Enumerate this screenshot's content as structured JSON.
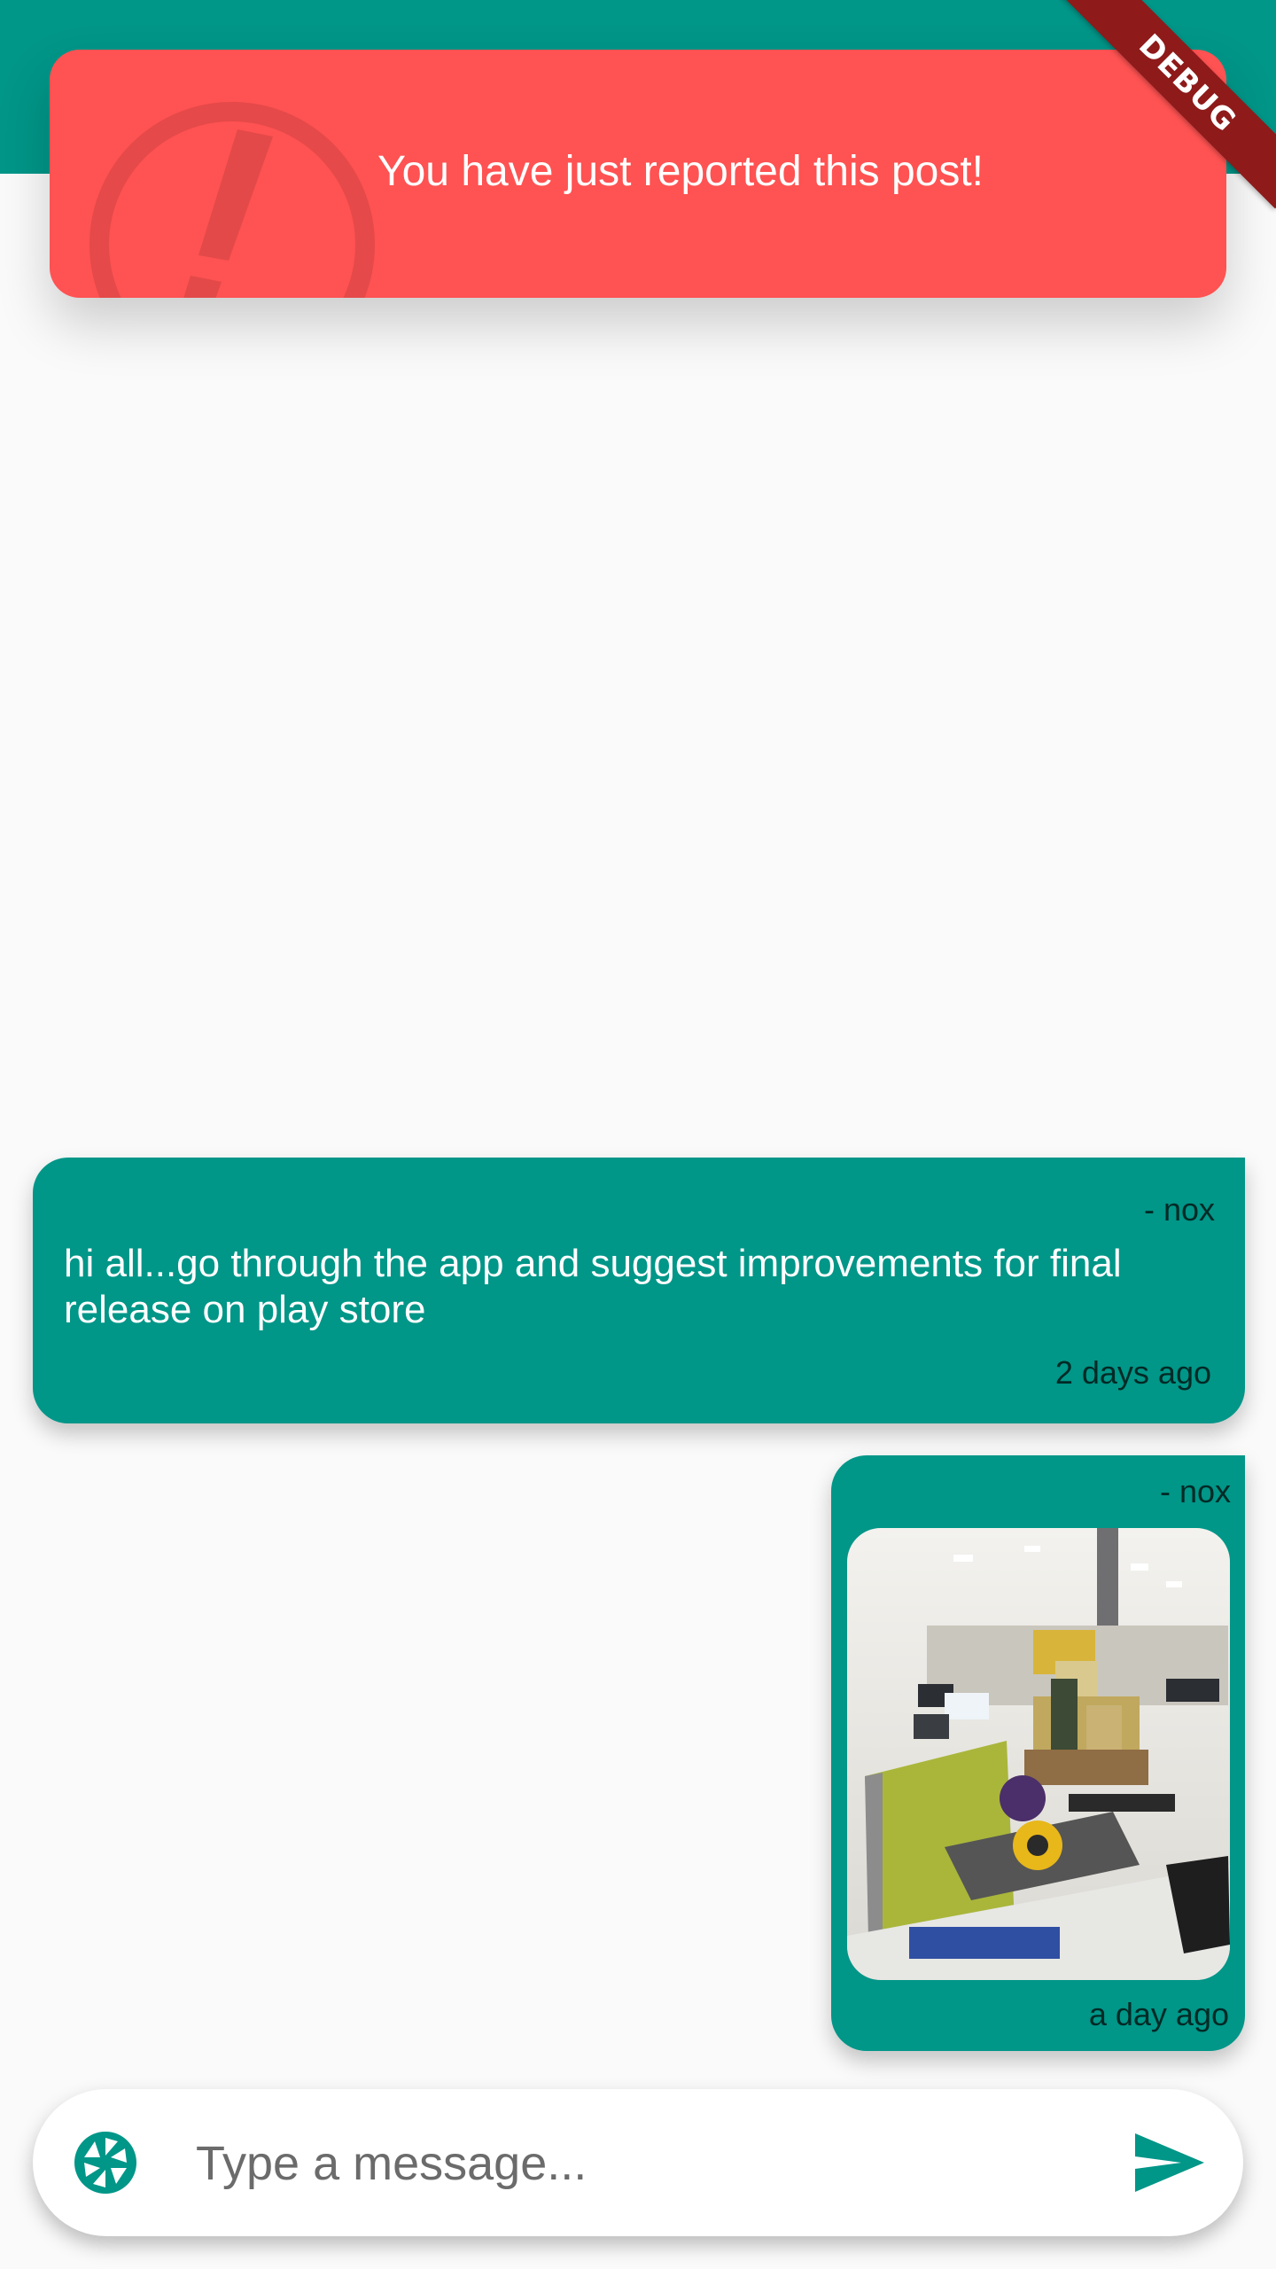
{
  "colors": {
    "primary": "#009688",
    "toast": "#FF5252",
    "background": "#FAFAFA",
    "debug": "#8E1A1A"
  },
  "toast": {
    "message": "You have just reported this post!",
    "icon": "alert-icon"
  },
  "debug_banner": {
    "label": "DEBUG"
  },
  "messages": [
    {
      "author": "- nox",
      "text": "hi all...go through the app and suggest improvements for final release on play store",
      "time": "2 days ago"
    },
    {
      "author": "- nox",
      "image": "office-desk-photo",
      "time": "a day ago"
    }
  ],
  "composer": {
    "placeholder": "Type a message...",
    "camera_icon": "camera-icon",
    "send_icon": "send-icon"
  }
}
